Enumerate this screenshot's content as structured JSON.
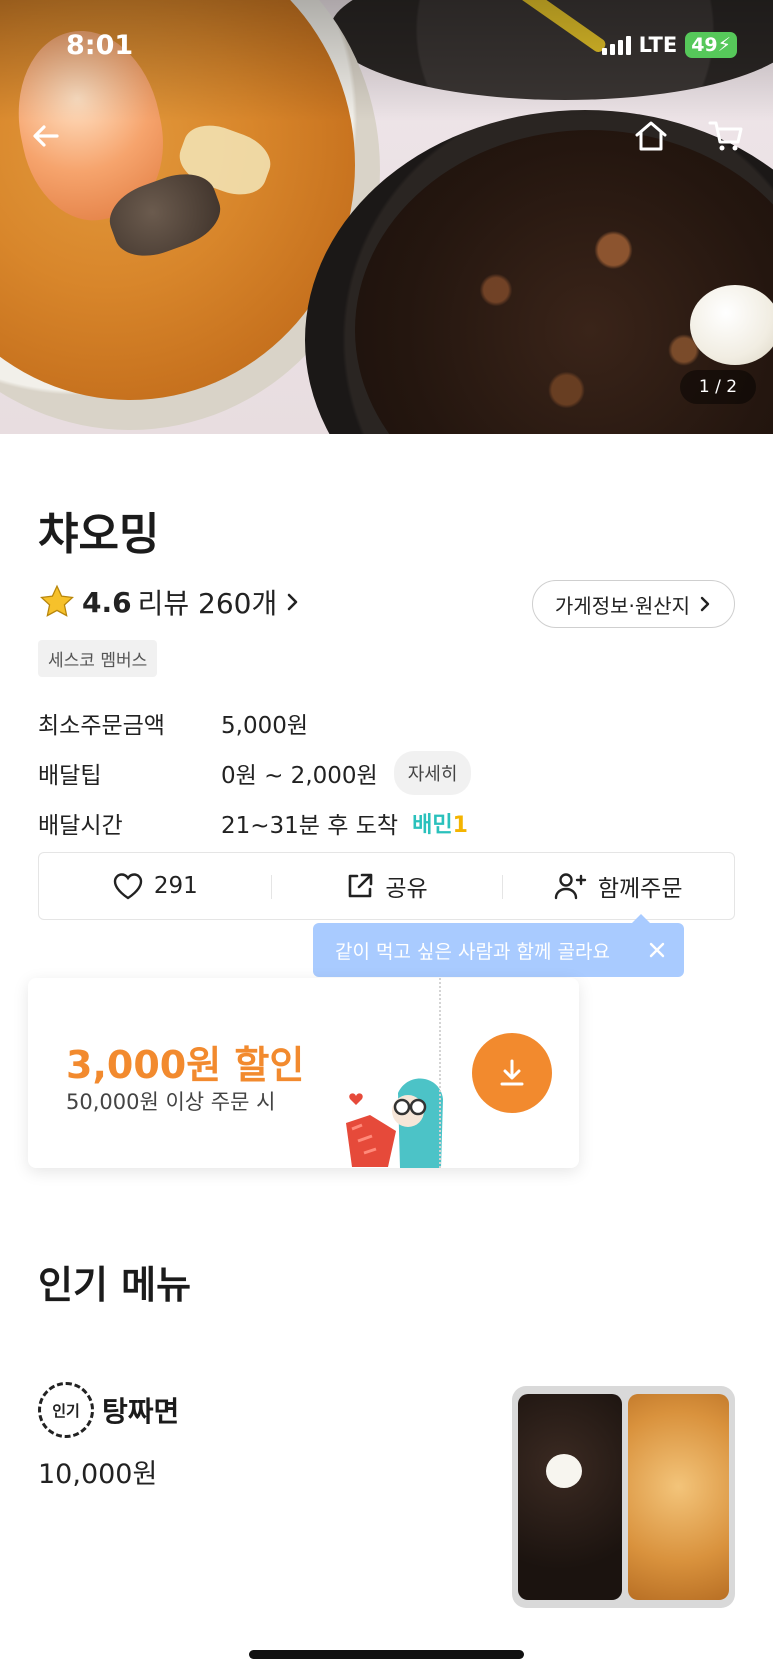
{
  "status_bar": {
    "time": "8:01",
    "network": "LTE",
    "battery": "49"
  },
  "hero": {
    "pager": "1 / 2"
  },
  "store": {
    "name": "챠오밍",
    "rating": "4.6",
    "review_label": "리뷰 260개",
    "info_button": "가게정보·원산지",
    "badge": "세스코 멤버스"
  },
  "info_rows": [
    {
      "key": "최소주문금액",
      "value": "5,000원"
    },
    {
      "key": "배달팁",
      "value": "0원 ~ 2,000원",
      "chip": "자세히"
    },
    {
      "key": "배달시간",
      "value": "21~31분 후 도착",
      "tag_text": "배민",
      "tag_num": "1"
    }
  ],
  "actions": {
    "like_count": "291",
    "share_label": "공유",
    "group_order_label": "함께주문"
  },
  "tooltip": {
    "text": "같이 먹고 싶은 사람과 함께 골라요"
  },
  "coupon": {
    "amount": "3,000원 할인",
    "condition": "50,000원 이상 주문 시"
  },
  "popular": {
    "title": "인기 메뉴",
    "items": [
      {
        "badge": "인기",
        "name": "탕짜면",
        "price": "10,000원"
      }
    ]
  },
  "colors": {
    "accent_orange": "#f28a2e",
    "tooltip_blue": "#a9cbff",
    "baemin_mint": "#2ac1bc",
    "star_yellow": "#f6c12b"
  }
}
